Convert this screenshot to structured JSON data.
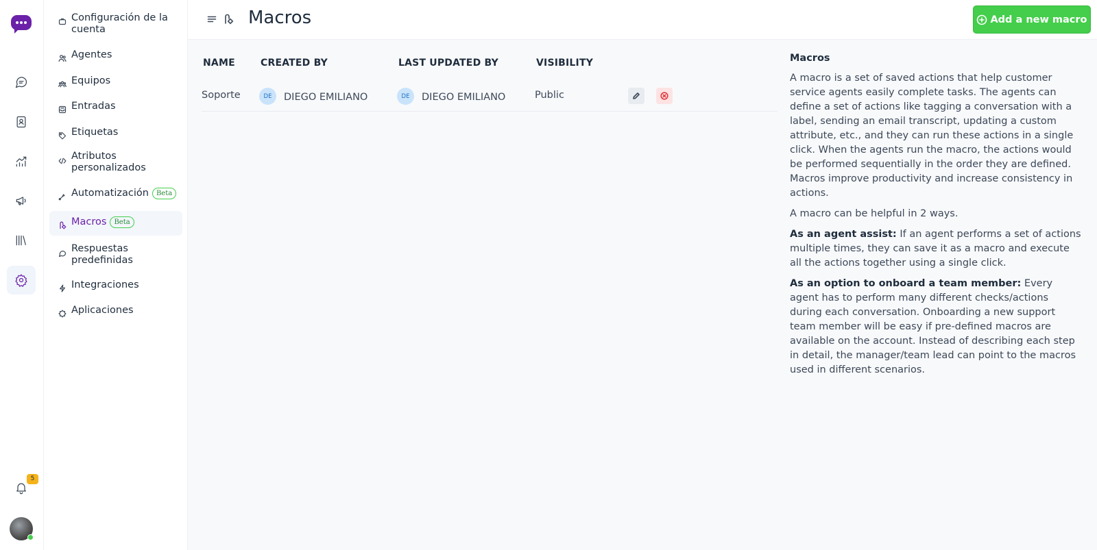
{
  "rail": {
    "notification_count": "5",
    "items": [
      "conversations-icon",
      "contacts-icon",
      "reports-icon",
      "campaigns-icon",
      "library-icon",
      "settings-icon"
    ]
  },
  "sidebar": {
    "items": [
      {
        "label": "Configuración de la cuenta",
        "icon": "briefcase-icon"
      },
      {
        "label": "Agentes",
        "icon": "people-icon"
      },
      {
        "label": "Equipos",
        "icon": "team-icon"
      },
      {
        "label": "Entradas",
        "icon": "inbox-icon"
      },
      {
        "label": "Etiquetas",
        "icon": "tag-icon"
      },
      {
        "label": "Atributos personalizados",
        "icon": "code-icon"
      },
      {
        "label": "Automatización",
        "icon": "automation-icon",
        "badge": "Beta"
      },
      {
        "label": "Macros",
        "icon": "macro-icon",
        "badge": "Beta",
        "active": true
      },
      {
        "label": "Respuestas predefinidas",
        "icon": "chat-icon"
      },
      {
        "label": "Integraciones",
        "icon": "flash-icon"
      },
      {
        "label": "Aplicaciones",
        "icon": "apps-icon"
      }
    ]
  },
  "header": {
    "title": "Macros",
    "add_button": "Add a new macro"
  },
  "table": {
    "columns": [
      "NAME",
      "CREATED BY",
      "LAST UPDATED BY",
      "VISIBILITY"
    ],
    "rows": [
      {
        "name": "Soporte",
        "created_by": {
          "initials": "DE",
          "name": "DIEGO EMILIANO"
        },
        "updated_by": {
          "initials": "DE",
          "name": "DIEGO EMILIANO"
        },
        "visibility": "Public"
      }
    ]
  },
  "info": {
    "title": "Macros",
    "p1": "A macro is a set of saved actions that help customer service agents easily complete tasks. The agents can define a set of actions like tagging a conversation with a label, sending an email transcript, updating a custom attribute, etc., and they can run these actions in a single click. When the agents run the macro, the actions would be performed sequentially in the order they are defined. Macros improve productivity and increase consistency in actions.",
    "p2": "A macro can be helpful in 2 ways.",
    "p3_bold": "As an agent assist:",
    "p3": " If an agent performs a set of actions multiple times, they can save it as a macro and execute all the actions together using a single click.",
    "p4_bold": "As an option to onboard a team member:",
    "p4": " Every agent has to perform many different checks/actions during each conversation. Onboarding a new support team member will be easy if pre-defined macros are available on the account. Instead of describing each step in detail, the manager/team lead can point to the macros used in different scenarios."
  },
  "colors": {
    "brand": "#6b21a8",
    "success": "#44ce4b",
    "danger": "#e0393e",
    "badge": "#f5b21b"
  }
}
